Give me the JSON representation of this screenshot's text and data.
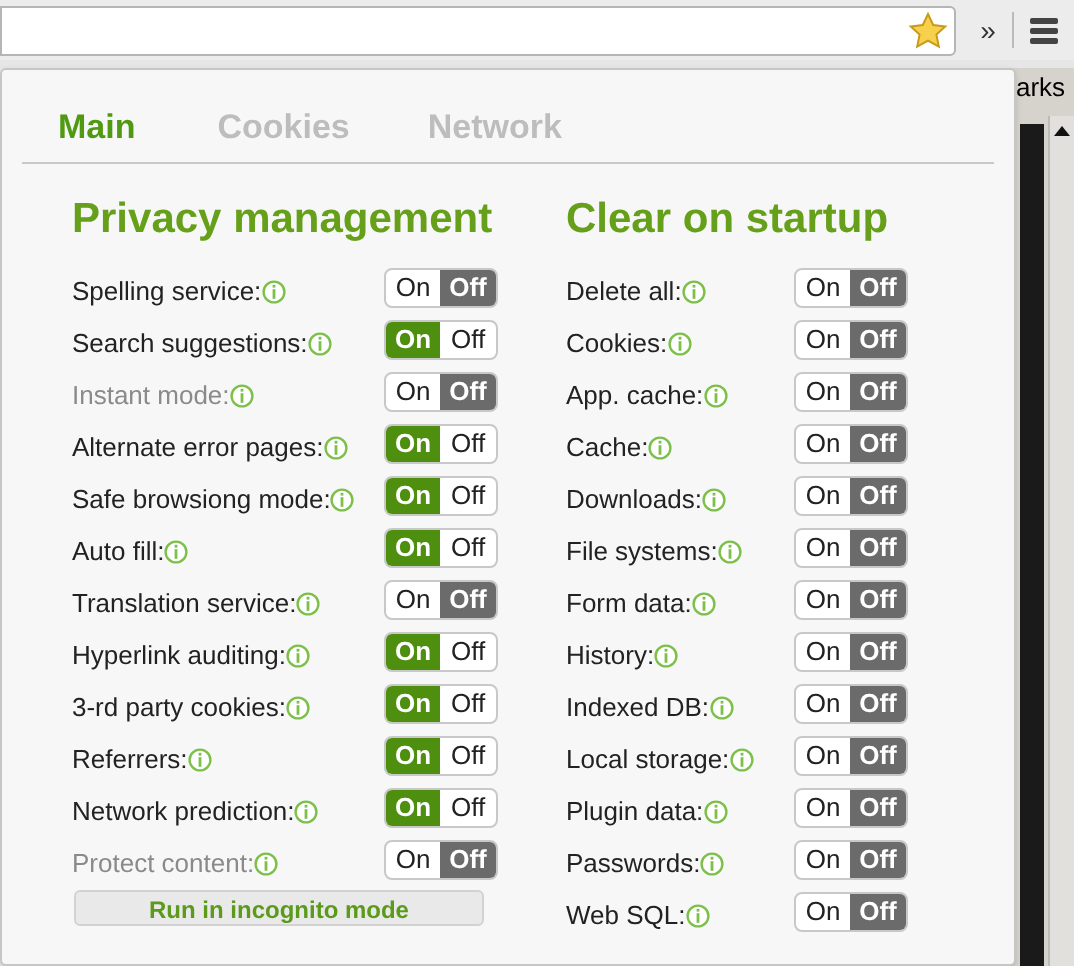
{
  "toolbar": {
    "overflow": "»",
    "bookmarks_label": "arks"
  },
  "tabs": [
    {
      "label": "Main",
      "selected": true
    },
    {
      "label": "Cookies",
      "selected": false
    },
    {
      "label": "Network",
      "selected": false
    }
  ],
  "sections": [
    {
      "title": "Privacy management",
      "settings": [
        {
          "label": "Spelling service:",
          "on": false,
          "disabled": false,
          "on_label": "On",
          "off_label": "Off"
        },
        {
          "label": "Search suggestions:",
          "on": true,
          "disabled": false,
          "on_label": "On",
          "off_label": "Off"
        },
        {
          "label": "Instant mode:",
          "on": false,
          "disabled": true,
          "on_label": "On",
          "off_label": "Off"
        },
        {
          "label": "Alternate error pages:",
          "on": true,
          "disabled": false,
          "on_label": "On",
          "off_label": "Off"
        },
        {
          "label": "Safe browsiong mode:",
          "on": true,
          "disabled": false,
          "on_label": "On",
          "off_label": "Off"
        },
        {
          "label": "Auto fill:",
          "on": true,
          "disabled": false,
          "on_label": "On",
          "off_label": "Off"
        },
        {
          "label": "Translation service:",
          "on": false,
          "disabled": false,
          "on_label": "On",
          "off_label": "Off"
        },
        {
          "label": "Hyperlink auditing:",
          "on": true,
          "disabled": false,
          "on_label": "On",
          "off_label": "Off"
        },
        {
          "label": "3-rd party cookies:",
          "on": true,
          "disabled": false,
          "on_label": "On",
          "off_label": "Off"
        },
        {
          "label": "Referrers:",
          "on": true,
          "disabled": false,
          "on_label": "On",
          "off_label": "Off"
        },
        {
          "label": "Network prediction:",
          "on": true,
          "disabled": false,
          "on_label": "On",
          "off_label": "Off"
        },
        {
          "label": "Protect content:",
          "on": false,
          "disabled": true,
          "on_label": "On",
          "off_label": "Off"
        }
      ],
      "button": "Run in incognito mode"
    },
    {
      "title": "Clear on startup",
      "settings": [
        {
          "label": "Delete all:",
          "on": false,
          "disabled": false,
          "on_label": "On",
          "off_label": "Off"
        },
        {
          "label": "Cookies:",
          "on": false,
          "disabled": false,
          "on_label": "On",
          "off_label": "Off"
        },
        {
          "label": "App. cache:",
          "on": false,
          "disabled": false,
          "on_label": "On",
          "off_label": "Off"
        },
        {
          "label": "Cache:",
          "on": false,
          "disabled": false,
          "on_label": "On",
          "off_label": "Off"
        },
        {
          "label": "Downloads:",
          "on": false,
          "disabled": false,
          "on_label": "On",
          "off_label": "Off"
        },
        {
          "label": "File systems:",
          "on": false,
          "disabled": false,
          "on_label": "On",
          "off_label": "Off"
        },
        {
          "label": "Form data:",
          "on": false,
          "disabled": false,
          "on_label": "On",
          "off_label": "Off"
        },
        {
          "label": "History:",
          "on": false,
          "disabled": false,
          "on_label": "On",
          "off_label": "Off"
        },
        {
          "label": "Indexed DB:",
          "on": false,
          "disabled": false,
          "on_label": "On",
          "off_label": "Off"
        },
        {
          "label": "Local storage:",
          "on": false,
          "disabled": false,
          "on_label": "On",
          "off_label": "Off"
        },
        {
          "label": "Plugin data:",
          "on": false,
          "disabled": false,
          "on_label": "On",
          "off_label": "Off"
        },
        {
          "label": "Passwords:",
          "on": false,
          "disabled": false,
          "on_label": "On",
          "off_label": "Off"
        },
        {
          "label": "Web SQL:",
          "on": false,
          "disabled": false,
          "on_label": "On",
          "off_label": "Off"
        }
      ]
    }
  ]
}
